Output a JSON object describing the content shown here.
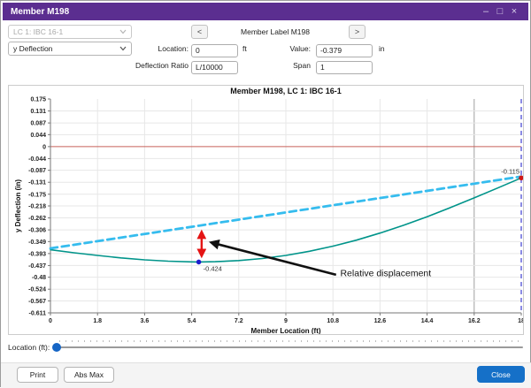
{
  "window": {
    "title": "Member M198",
    "controls": {
      "minimize": "–",
      "maximize": "□",
      "close": "×"
    }
  },
  "toolbar": {
    "lc_dropdown_value": "LC 1: IBC 16-1",
    "type_dropdown_value": "y Deflection",
    "prev_label": "<",
    "next_label": ">",
    "member_label": "Member Label M198",
    "location_label": "Location:",
    "location_value": "0",
    "location_unit": "ft",
    "value_label": "Value:",
    "value_value": "-0.379",
    "value_unit": "in",
    "ratio_label": "Deflection Ratio",
    "ratio_value": "L/10000",
    "span_label": "Span",
    "span_value": "1"
  },
  "slider": {
    "label": "Location (ft):"
  },
  "footer": {
    "print_label": "Print",
    "abs_max_label": "Abs Max",
    "close_label": "Close"
  },
  "chart_data": {
    "type": "line",
    "title": "Member M198, LC 1: IBC 16-1",
    "xlabel": "Member Location (ft)",
    "ylabel": "y Deflection (in)",
    "xlim": [
      0,
      18
    ],
    "ylim": [
      -0.611,
      0.175
    ],
    "xticks": [
      "0",
      "1.8",
      "3.6",
      "5.4",
      "7.2",
      "9",
      "10.8",
      "12.6",
      "14.4",
      "16.2",
      "18"
    ],
    "yticks": [
      "0.175",
      "0.131",
      "0.087",
      "0.044",
      "0",
      "-0.044",
      "-0.087",
      "-0.131",
      "-0.175",
      "-0.218",
      "-0.262",
      "-0.306",
      "-0.349",
      "-0.393",
      "-0.437",
      "-0.48",
      "-0.524",
      "-0.567",
      "-0.611"
    ],
    "grid": true,
    "dark_gridline_x": 16.2,
    "colors": {
      "grid": "#e7e7e7",
      "grid_dark": "#9f9f9f",
      "axis": "#777777",
      "zero_line": "#c7605a",
      "end_line": "#5a5ad8",
      "rel_arrow": "#e41414",
      "curve": "#00948a",
      "chord": "#35bcee"
    },
    "series": [
      {
        "name": "deflected-shape-curve",
        "color": "#00948a",
        "width": 1.6,
        "dash": "",
        "points": [
          [
            0,
            -0.379
          ],
          [
            0.9,
            -0.39
          ],
          [
            1.8,
            -0.4
          ],
          [
            2.7,
            -0.409
          ],
          [
            3.6,
            -0.416
          ],
          [
            4.5,
            -0.421
          ],
          [
            5.4,
            -0.4235
          ],
          [
            5.67,
            -0.424
          ],
          [
            6.3,
            -0.4228
          ],
          [
            7.2,
            -0.4187
          ],
          [
            8.1,
            -0.4111
          ],
          [
            9,
            -0.3998
          ],
          [
            9.9,
            -0.3847
          ],
          [
            10.8,
            -0.3659
          ],
          [
            11.7,
            -0.3436
          ],
          [
            12.6,
            -0.3178
          ],
          [
            13.5,
            -0.289
          ],
          [
            14.4,
            -0.2576
          ],
          [
            15.3,
            -0.224
          ],
          [
            16.2,
            -0.1886
          ],
          [
            17.1,
            -0.1521
          ],
          [
            18,
            -0.115
          ]
        ]
      },
      {
        "name": "chord-reference-line",
        "color": "#35bcee",
        "width": 2.8,
        "dash": "8 5",
        "points": [
          [
            0,
            -0.374
          ],
          [
            18,
            -0.11
          ]
        ]
      }
    ],
    "markers": [
      {
        "name": "max-deflection-point",
        "x": 5.67,
        "y": -0.424,
        "color": "#1d1dcf",
        "label": "-0.424",
        "anchor": "start",
        "dx": 5,
        "dy": 10
      },
      {
        "name": "end-deflection-point",
        "x": 18,
        "y": -0.115,
        "color": "#cf1717",
        "label": "-0.115",
        "anchor": "end",
        "dx": -2,
        "dy": -5
      }
    ],
    "annotations": {
      "relative_arrow": {
        "x": 5.78,
        "y1": -0.315,
        "y2": -0.4,
        "color": "#e41414"
      },
      "pointer_arrow": {
        "x1": 10.92,
        "y1": -0.471,
        "x2": 6.17,
        "y2": -0.353
      },
      "note": {
        "x": 11.08,
        "y": -0.477,
        "label": "Relative displacement"
      }
    }
  }
}
